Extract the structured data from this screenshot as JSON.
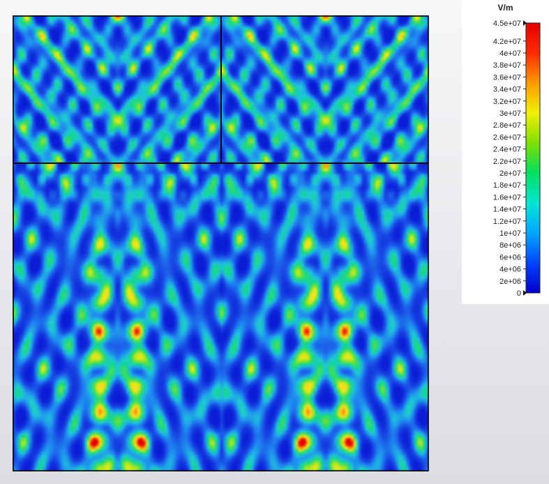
{
  "chart_data": {
    "type": "heatmap",
    "title": "",
    "unit": "V/m",
    "colormap": [
      "#0000cc",
      "#0044ff",
      "#00a8ff",
      "#00e6d2",
      "#00e060",
      "#7fe000",
      "#f0f000",
      "#ff9a00",
      "#ff2a00",
      "#e60000"
    ],
    "field_color_stops": [
      "#0b1bd6",
      "#1a4de6",
      "#1f8cf0",
      "#1ec8d6",
      "#14d78c",
      "#55e04a",
      "#c9e81a",
      "#ffe21a",
      "#ff7a10",
      "#e80000"
    ],
    "color_range": [
      0,
      45000000
    ],
    "tick_labels": [
      "4.5e+07",
      "4.2e+07",
      "4e+07",
      "3.8e+07",
      "3.6e+07",
      "3.4e+07",
      "3.2e+07",
      "3e+07",
      "2.8e+07",
      "2.6e+07",
      "2.4e+07",
      "2.2e+07",
      "2e+07",
      "1.8e+07",
      "1.6e+07",
      "1.4e+07",
      "1.2e+07",
      "1e+07",
      "8e+06",
      "6e+06",
      "4e+06",
      "2e+06",
      "0"
    ],
    "tick_values": [
      45000000,
      42000000,
      40000000,
      38000000,
      36000000,
      34000000,
      32000000,
      30000000,
      28000000,
      26000000,
      24000000,
      22000000,
      20000000,
      18000000,
      16000000,
      14000000,
      12000000,
      10000000,
      8000000,
      6000000,
      4000000,
      2000000,
      0
    ],
    "legend_position": "right",
    "grid": false
  }
}
